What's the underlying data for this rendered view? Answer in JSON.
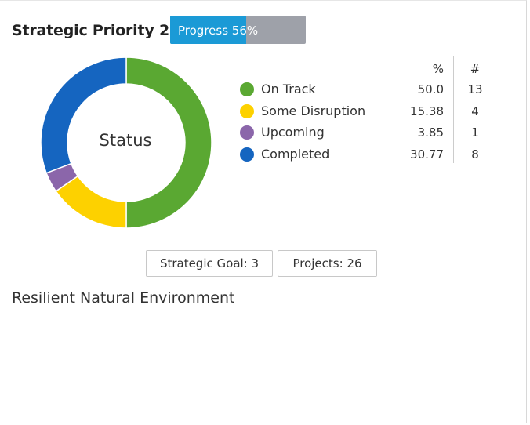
{
  "header": {
    "title": "Strategic Priority 2",
    "progress_label": "Progress 56%",
    "progress_value": 0.56,
    "progress_fill_color": "#1b9ad6",
    "progress_track_color": "#9ea1a9"
  },
  "chart_data": {
    "type": "pie",
    "variant": "donut",
    "center_label": "Status",
    "table_headers": {
      "pct": "%",
      "count": "#"
    },
    "slices": [
      {
        "label": "On Track",
        "pct": "50.0",
        "count": "13",
        "value": 13,
        "color": "#5aa832"
      },
      {
        "label": "Some Disruption",
        "pct": "15.38",
        "count": "4",
        "value": 4,
        "color": "#fdd100"
      },
      {
        "label": "Upcoming",
        "pct": "3.85",
        "count": "1",
        "value": 1,
        "color": "#8b66aa"
      },
      {
        "label": "Completed",
        "pct": "30.77",
        "count": "8",
        "value": 8,
        "color": "#1565c0"
      }
    ]
  },
  "footer": {
    "goal_label": "Strategic Goal: 3",
    "projects_label": "Projects: 26",
    "subtitle": "Resilient Natural Environment"
  }
}
